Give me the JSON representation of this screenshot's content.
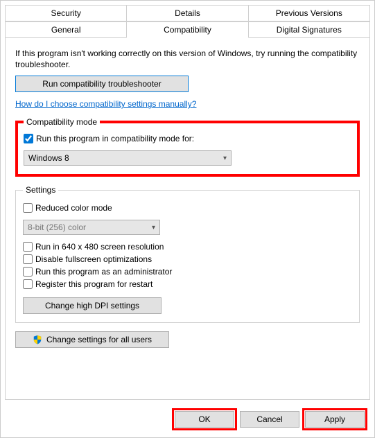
{
  "tabs_row1": [
    "Security",
    "Details",
    "Previous Versions"
  ],
  "tabs_row2": [
    "General",
    "Compatibility",
    "Digital Signatures"
  ],
  "intro": "If this program isn't working correctly on this version of Windows, try running the compatibility troubleshooter.",
  "run_troubleshooter": "Run compatibility troubleshooter",
  "help_link": "How do I choose compatibility settings manually?",
  "compat_mode": {
    "legend": "Compatibility mode",
    "checkbox_label": "Run this program in compatibility mode for:",
    "selected_os": "Windows 8"
  },
  "settings": {
    "legend": "Settings",
    "reduced_color": "Reduced color mode",
    "color_combo": "8-bit (256) color",
    "run_640": "Run in 640 x 480 screen resolution",
    "disable_fs": "Disable fullscreen optimizations",
    "run_admin": "Run this program as an administrator",
    "register_restart": "Register this program for restart",
    "dpi_btn": "Change high DPI settings"
  },
  "all_users_btn": "Change settings for all users",
  "buttons": {
    "ok": "OK",
    "cancel": "Cancel",
    "apply": "Apply"
  }
}
